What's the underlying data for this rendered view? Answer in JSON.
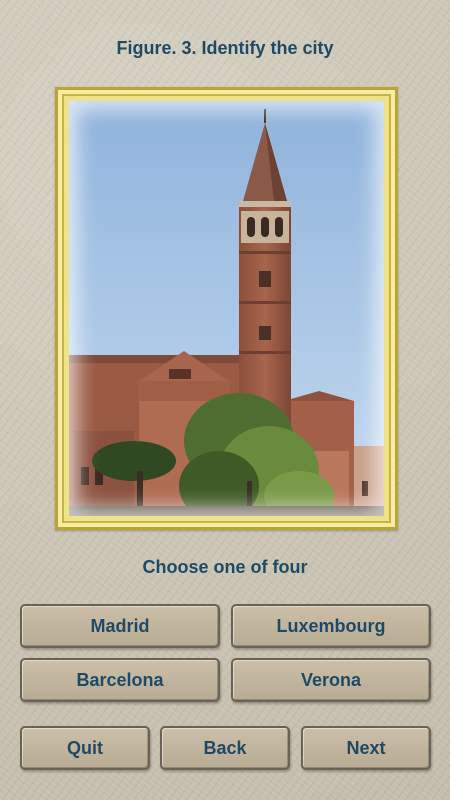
{
  "header": {
    "title": "Figure. 3. Identify the city"
  },
  "prompt": {
    "text": "Choose one of four"
  },
  "answers": [
    {
      "label": "Madrid"
    },
    {
      "label": "Luxembourg"
    },
    {
      "label": "Barcelona"
    },
    {
      "label": "Verona"
    }
  ],
  "nav": {
    "quit_label": "Quit",
    "back_label": "Back",
    "next_label": "Next"
  },
  "colors": {
    "text": "#1f4a66",
    "button_bg": "#c3b7a0",
    "frame_gold": "#efe38a",
    "background": "#cfc8b9"
  }
}
